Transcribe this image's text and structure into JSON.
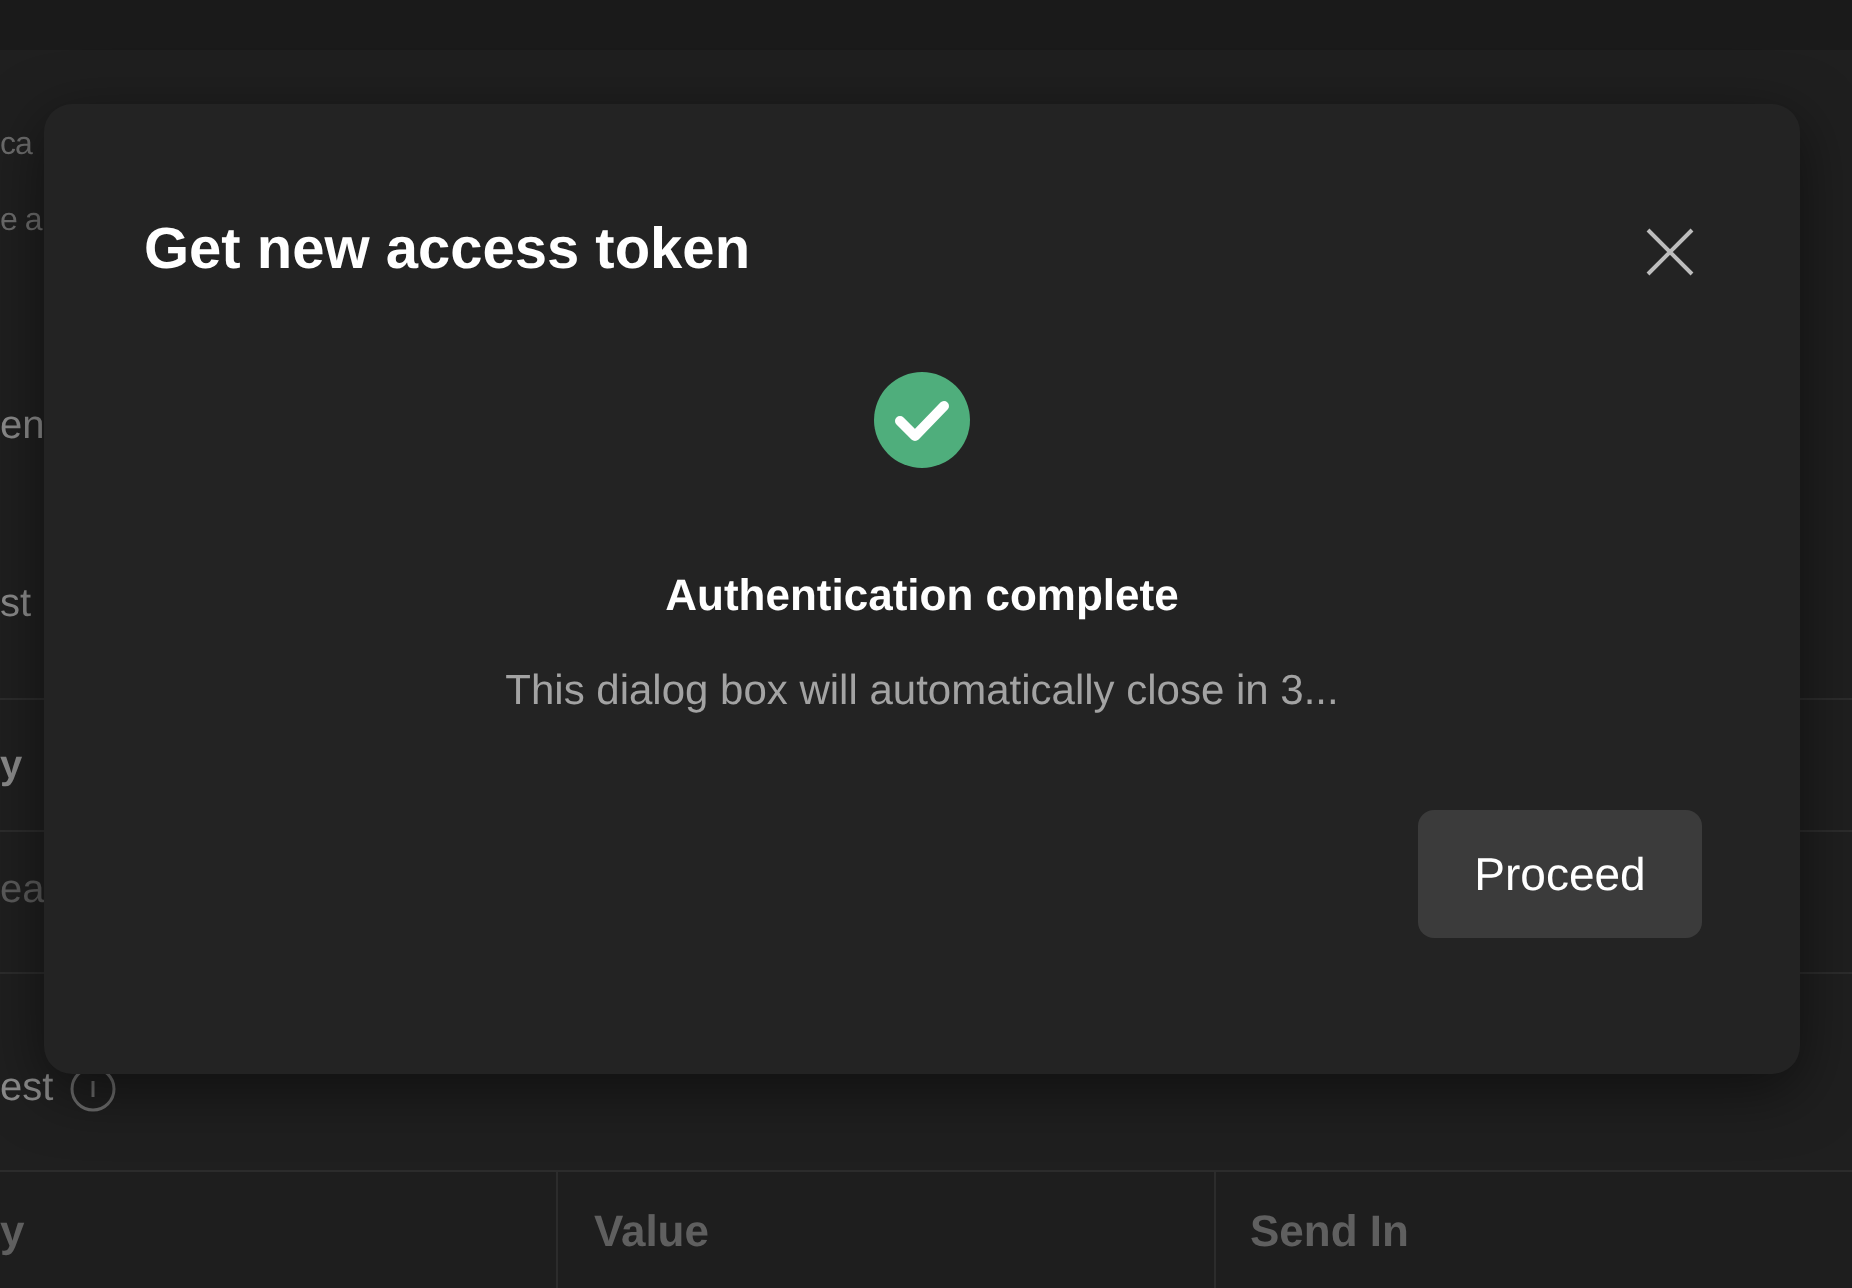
{
  "background": {
    "lines": [
      {
        "text": "ca",
        "kind": "muted"
      },
      {
        "text": "e a",
        "kind": "muted"
      },
      {
        "text": "en",
        "kind": "label"
      },
      {
        "text": "st",
        "kind": "label"
      },
      {
        "text": "y",
        "kind": "heading"
      },
      {
        "text": "ea",
        "kind": "placeholder"
      },
      {
        "text": "est",
        "kind": "info"
      }
    ],
    "table": {
      "columns": [
        "y",
        "Value",
        "Send In"
      ]
    }
  },
  "dialog": {
    "title": "Get new access token",
    "status": "Authentication complete",
    "message": "This dialog box will automatically close in 3...",
    "button": "Proceed"
  }
}
